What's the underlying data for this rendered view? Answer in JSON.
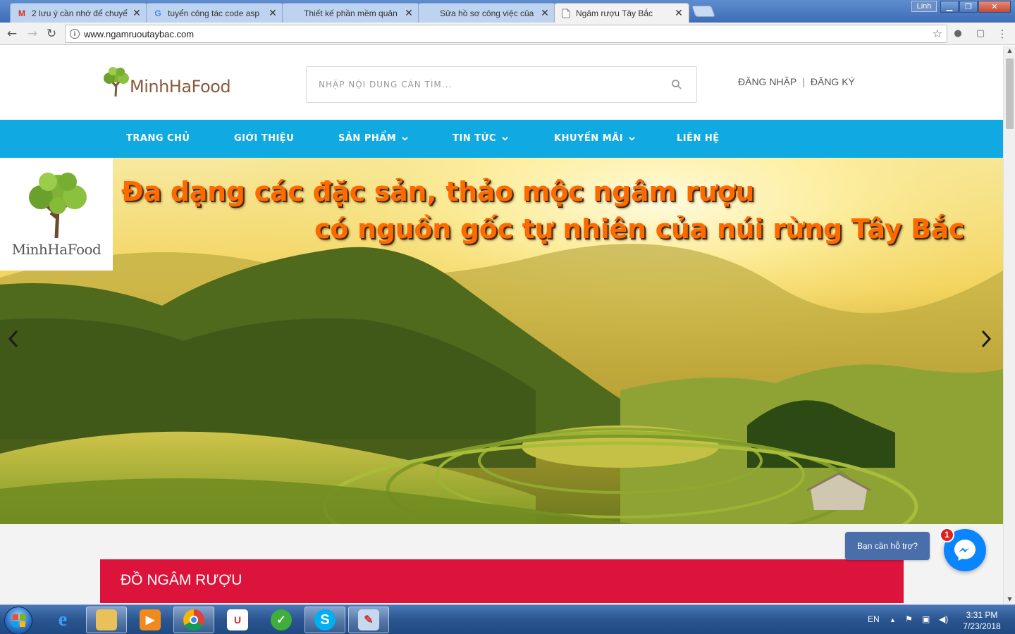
{
  "browser": {
    "tabs": [
      {
        "title": "2 lưu ý cần nhớ để chuyể",
        "favicon": "gmail-icon",
        "active": false
      },
      {
        "title": "tuyển công tác code asp",
        "favicon": "google-icon",
        "active": false
      },
      {
        "title": "Thiết kế phần mềm quản",
        "favicon": "upwork-icon",
        "active": false
      },
      {
        "title": "Sửa hồ sơ công việc của",
        "favicon": "upwork-icon",
        "active": false
      },
      {
        "title": "Ngâm rượu Tây Bắc",
        "favicon": "page-icon",
        "active": true
      }
    ],
    "profile_label": "Linh",
    "url": "www.ngamruoutaybac.com"
  },
  "site": {
    "logo_text": "MinhHaFood",
    "search_placeholder": "NHẬP NỘI DUNG CẦN TÌM...",
    "login_label": "ĐĂNG NHẬP",
    "auth_separator": "|",
    "register_label": "ĐĂNG KÝ",
    "nav": [
      {
        "label": "TRANG CHỦ",
        "has_dropdown": false
      },
      {
        "label": "GIỚI THIỆU",
        "has_dropdown": false
      },
      {
        "label": "SẢN PHẨM",
        "has_dropdown": true
      },
      {
        "label": "TIN TỨC",
        "has_dropdown": true
      },
      {
        "label": "KHUYẾN MÃI",
        "has_dropdown": true
      },
      {
        "label": "LIÊN HỆ",
        "has_dropdown": false
      }
    ],
    "banner": {
      "badge_text": "MinhHaFood",
      "line1": "Đa dạng các đặc sản, thảo mộc ngâm rượu",
      "line2": "có nguồn gốc tự nhiên của núi rừng Tây Bắc"
    },
    "section_title": "ĐỒ NGÂM RƯỢU",
    "help_label": "Bạn cần hỗ trợ?",
    "messenger_badge": "1"
  },
  "taskbar": {
    "language": "EN",
    "time": "3:31 PM",
    "date": "7/23/2018"
  },
  "colors": {
    "nav_blue": "#11a9e2",
    "section_red": "#dc143c",
    "headline_orange": "#ff6a00",
    "messenger_blue": "#0a84ff",
    "help_button": "#4a6ea9"
  }
}
